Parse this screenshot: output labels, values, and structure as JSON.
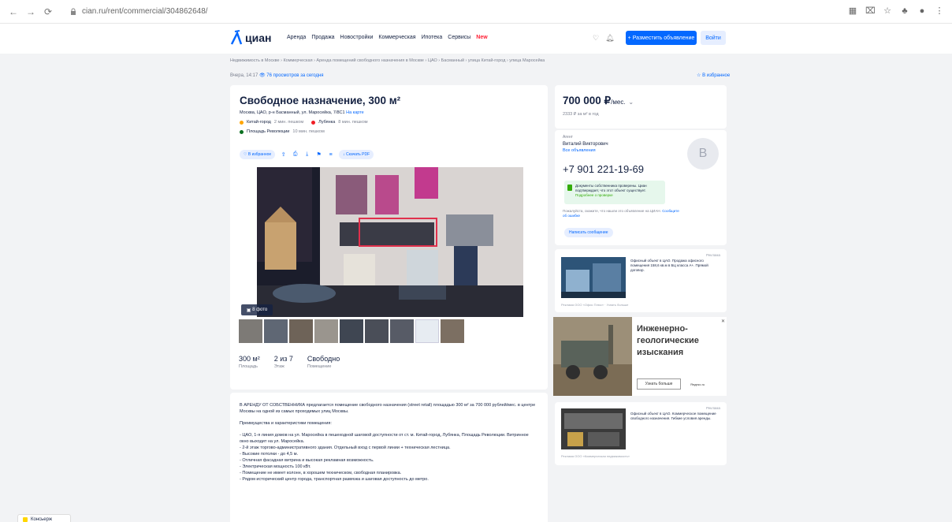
{
  "browser": {
    "url": "cian.ru/rent/commercial/304862648/"
  },
  "header": {
    "logo_text": "циан",
    "nav": [
      "Аренда",
      "Продажа",
      "Новостройки",
      "Коммерческая",
      "Ипотека",
      "Ипотека",
      "Сервисы"
    ],
    "nav_new": "New",
    "place_button": "+ Разместить объявление",
    "login_button": "Войти"
  },
  "breadcrumb": "Недвижимость в Москве › Коммерческая › Аренда помещений свободного назначения в Москве › ЦАО › Басманный › улица Китай-город › улица Маросейка",
  "updated": {
    "text": "Вчера, 14:17",
    "views": "76 просмотров",
    "today": "за сегодня"
  },
  "favorite_top": "В избранное",
  "listing": {
    "title": "Свободное назначение, 300 м²",
    "address": "Москва, ЦАО, р-н Басманный, ул. Маросейка, 7/8С1",
    "map_link": "На карте",
    "metro": [
      {
        "name": "Китай-город",
        "time": "2 мин. пешком",
        "color": "#ffa500"
      },
      {
        "name": "Лубянка",
        "time": "8 мин. пешком",
        "color": "#ef1e25"
      },
      {
        "name": "Площадь Революции",
        "time": "10 мин. пешком",
        "color": "#0a6f20"
      }
    ],
    "actions": {
      "favorite": "В избранное",
      "pdf": "Скачать PDF"
    },
    "photo_count": "8 фото",
    "facts": [
      {
        "value": "300 м²",
        "label": "Площадь"
      },
      {
        "value": "2 из 7",
        "label": "Этаж"
      },
      {
        "value": "Свободно",
        "label": "Помещение"
      }
    ]
  },
  "description": [
    "В АРЕНДУ ОТ СОБСТВЕННИКА предлагается помещение свободного назначения (street retail) площадью 300 м² за 700 000 рублей/мес. в центре Москвы на одной из самых проходимых улиц Москвы.",
    "Преимущества и характеристики помещения:",
    "- ЦАО, 1-я линия домов на ул. Маросейка в пешеходной шаговой доступности от ст. м. Китай-город, Лубянка, Площадь Революции. Витринное окно выходит на ул. Маросейка.",
    "- 2-й этаж торгово-административного здания. Отдельный вход с первой линии + техническая лестница.",
    "- Высокие потолки - до 4,5 м.",
    "- Отличная фасадная витрина и высокая рекламная возможность.",
    "- Электрическая мощность 100 кВт.",
    "- Помещение не имеет колонн, в хорошем техническом, свободная планировка.",
    "- Рядом исторический центр города, транспортная развязка и шаговая доступность до метро."
  ],
  "price": {
    "value": "700 000 ₽",
    "unit": "/мес.",
    "sub": "2333 ₽ за м² в год"
  },
  "agent": {
    "role": "Агент",
    "name": "Виталий Викторович",
    "docs": "Все объявления",
    "avatar_letter": "В",
    "phone": "+7 901 221-19-69",
    "verification": "Документы собственника проверены. Циан подтверждает, что этот объект существует.",
    "verification_more": "Подробнее о проверке",
    "note": "Пожалуйста, скажите, что нашли это объявление на ЦИАН.",
    "note_link": "Сообщите об ошибке",
    "message_button": "Написать сообщение"
  },
  "ads": [
    {
      "tag": "Реклама",
      "text": "Офисный объект в ЦАО. Продажа офисного помещения 158,6 кв.м в БЦ класса А+. Прямой договор.",
      "footer": "Реклама ООО «Офис Плюс» · Узнать больше"
    },
    {
      "tag": "Реклама",
      "text": "Офисный объект в ЦАО. Коммерческое помещение свободного назначения. Гибкие условия аренды.",
      "footer": "Реклама ООО «Коммерческая недвижимость»"
    }
  ],
  "bigad": {
    "title": "Инженерно-геологические изыскания",
    "button": "Узнать больше",
    "site": "Яндекс.ru"
  },
  "bottom_tab": "Консьерж"
}
